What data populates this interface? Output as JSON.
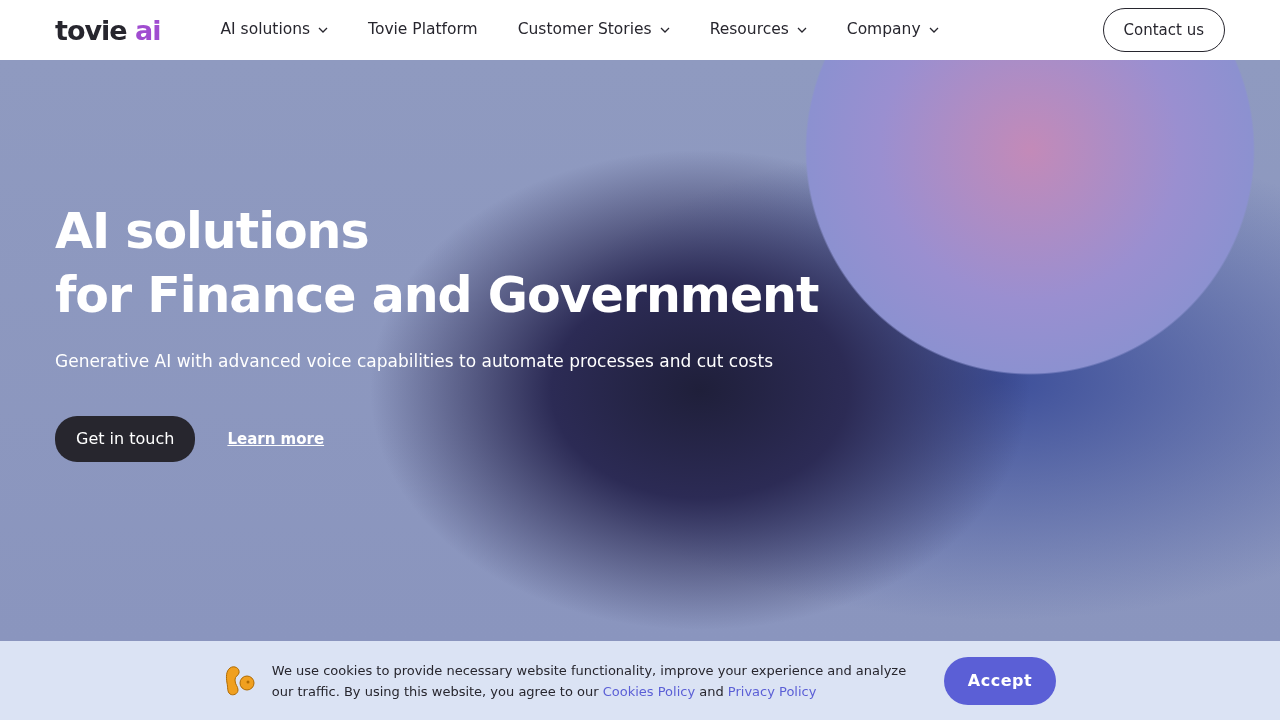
{
  "header": {
    "logo": {
      "word": "tovie",
      "accent": "ai"
    },
    "nav": [
      {
        "label": "AI solutions",
        "dropdown": true
      },
      {
        "label": "Tovie Platform",
        "dropdown": false
      },
      {
        "label": "Customer Stories",
        "dropdown": true
      },
      {
        "label": "Resources",
        "dropdown": true
      },
      {
        "label": "Company",
        "dropdown": true
      }
    ],
    "contact_button": "Contact us"
  },
  "hero": {
    "title_lines": [
      "AI solutions",
      "for Finance and Government"
    ],
    "subtitle": "Generative AI with advanced voice capabilities to automate processes and cut costs",
    "primary_button": "Get in touch",
    "link": "Learn more"
  },
  "cookie_banner": {
    "text_before": "We use cookies to provide necessary website functionality, improve your experience and analyze our traffic. By using this website, you agree to our",
    "links": [
      "Cookies Policy",
      "Privacy Policy"
    ],
    "joiner": "and",
    "button": "Accept"
  }
}
